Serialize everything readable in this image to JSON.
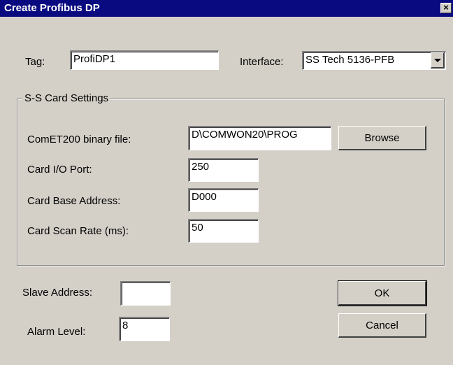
{
  "window": {
    "title": "Create Profibus DP",
    "close_glyph": "×"
  },
  "tag": {
    "label": "Tag:",
    "value": "ProfiDP1"
  },
  "interface": {
    "label": "Interface:",
    "value": "SS Tech 5136-PFB"
  },
  "card_settings": {
    "title": "S-S Card Settings",
    "comet_file": {
      "label": "ComET200 binary file:",
      "value": "D\\COMWON20\\PROG"
    },
    "browse_label": "Browse",
    "io_port": {
      "label": "Card I/O Port:",
      "value": "250"
    },
    "base_address": {
      "label": "Card Base Address:",
      "value": "D000"
    },
    "scan_rate": {
      "label": "Card Scan Rate (ms):",
      "value": "50"
    }
  },
  "slave_address": {
    "label": "Slave Address:",
    "value": ""
  },
  "alarm_level": {
    "label": "Alarm Level:",
    "value": "8"
  },
  "buttons": {
    "ok": "OK",
    "cancel": "Cancel"
  },
  "colors": {
    "titlebar": "#0a0a80",
    "dialog_bg": "#d4d0c8"
  }
}
